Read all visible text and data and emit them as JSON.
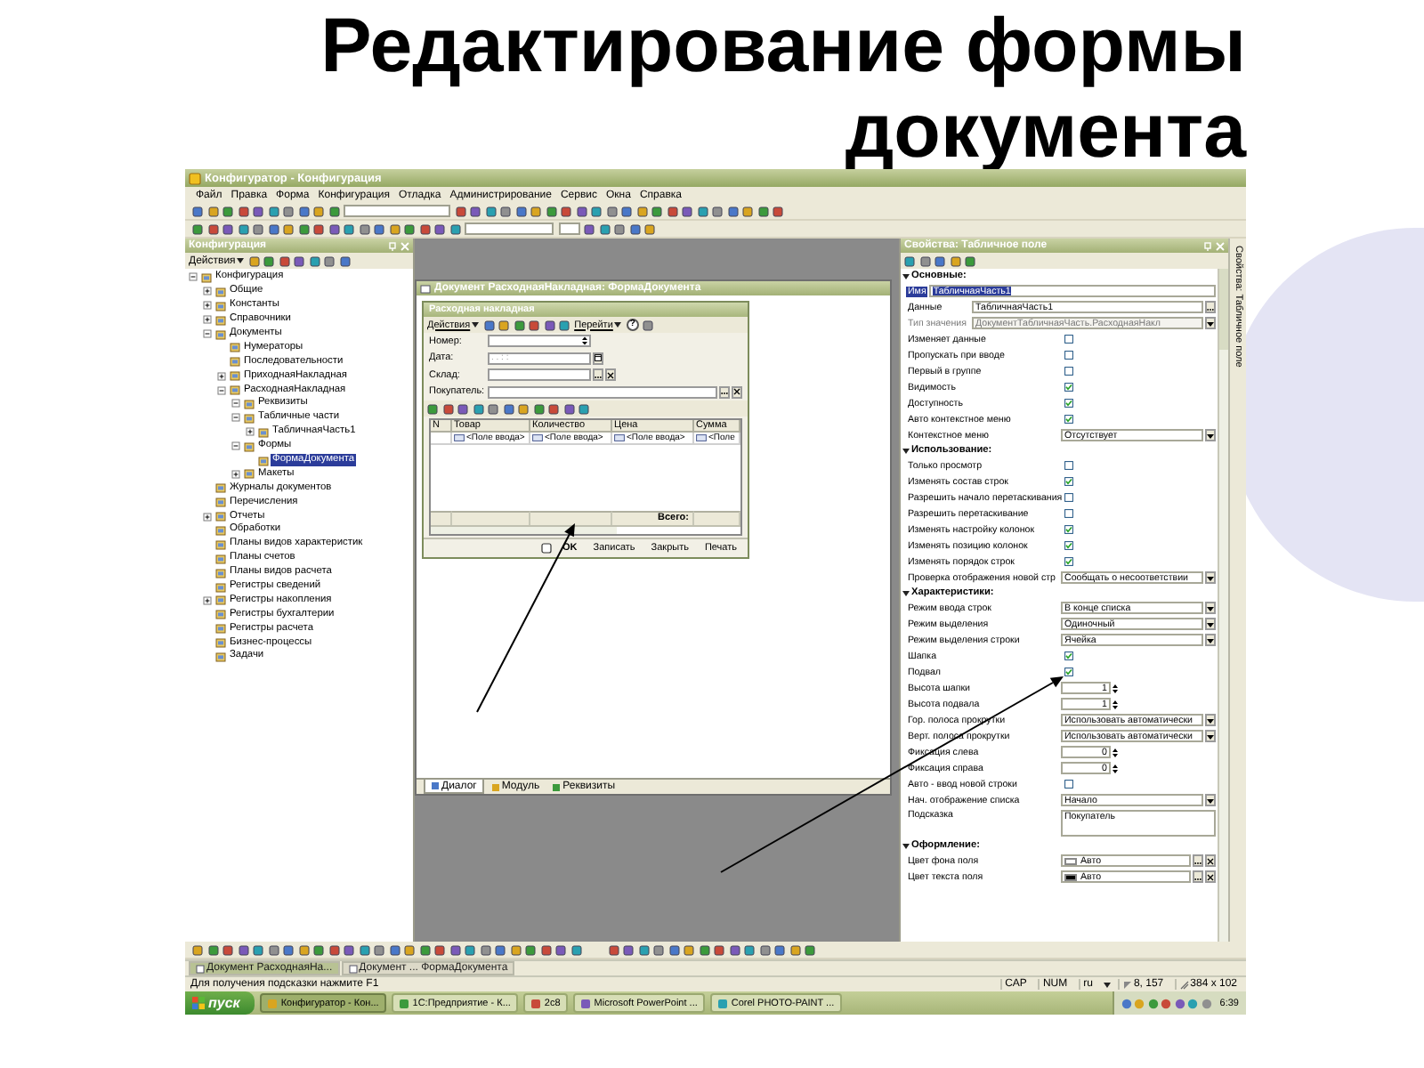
{
  "slide": {
    "title": "Редактирование формы документа"
  },
  "app": {
    "title": "Конфигуратор - Конфигурация",
    "menu": [
      "Файл",
      "Правка",
      "Форма",
      "Конфигурация",
      "Отладка",
      "Администрирование",
      "Сервис",
      "Окна",
      "Справка"
    ],
    "tree_panel": {
      "title": "Конфигурация",
      "actions_label": "Действия",
      "items": [
        {
          "label": "Конфигурация",
          "expanded": true,
          "selected": false,
          "children": [
            {
              "label": "Общие",
              "expanded": false,
              "selected": false
            },
            {
              "label": "Константы",
              "expanded": false,
              "selected": false
            },
            {
              "label": "Справочники",
              "expanded": false,
              "selected": false
            },
            {
              "label": "Документы",
              "expanded": true,
              "selected": false,
              "children": [
                {
                  "label": "Нумераторы",
                  "selected": false
                },
                {
                  "label": "Последовательности",
                  "selected": false
                },
                {
                  "label": "ПриходнаяНакладная",
                  "expanded": false,
                  "selected": false
                },
                {
                  "label": "РасходнаяНакладная",
                  "expanded": true,
                  "selected": false,
                  "children": [
                    {
                      "label": "Реквизиты",
                      "expanded": true,
                      "selected": false
                    },
                    {
                      "label": "Табличные части",
                      "expanded": true,
                      "selected": false,
                      "children": [
                        {
                          "label": "ТабличнаяЧасть1",
                          "expanded": false,
                          "selected": false
                        }
                      ]
                    },
                    {
                      "label": "Формы",
                      "expanded": true,
                      "selected": false,
                      "children": [
                        {
                          "label": "ФормаДокумента",
                          "selected": true
                        }
                      ]
                    },
                    {
                      "label": "Макеты",
                      "expanded": false,
                      "selected": false
                    }
                  ]
                }
              ]
            },
            {
              "label": "Журналы документов",
              "selected": false
            },
            {
              "label": "Перечисления",
              "selected": false
            },
            {
              "label": "Отчеты",
              "expanded": false,
              "selected": false
            },
            {
              "label": "Обработки",
              "selected": false
            },
            {
              "label": "Планы видов характеристик",
              "selected": false
            },
            {
              "label": "Планы счетов",
              "selected": false
            },
            {
              "label": "Планы видов расчета",
              "selected": false
            },
            {
              "label": "Регистры сведений",
              "selected": false
            },
            {
              "label": "Регистры накопления",
              "expanded": false,
              "selected": false
            },
            {
              "label": "Регистры бухгалтерии",
              "selected": false
            },
            {
              "label": "Регистры расчета",
              "selected": false
            },
            {
              "label": "Бизнес-процессы",
              "selected": false
            },
            {
              "label": "Задачи",
              "selected": false
            }
          ]
        }
      ]
    },
    "designer": {
      "title": "Документ РасходнаяНакладная: ФормаДокумента",
      "form": {
        "title": "Расходная накладная",
        "actions_label": "Действия",
        "goto_label": "Перейти",
        "help": "?",
        "fields": [
          {
            "label": "Номер:",
            "kind": "number",
            "wide": false
          },
          {
            "label": "Дата:",
            "kind": "date",
            "placeholder": ". . : :",
            "wide": false
          },
          {
            "label": "Склад:",
            "kind": "select",
            "wide": false
          },
          {
            "label": "Покупатель:",
            "kind": "select",
            "wide": true
          }
        ],
        "table": {
          "columns": [
            "N",
            "Товар",
            "Количество",
            "Цена",
            "Сумма"
          ],
          "rows": [
            [
              "",
              "<Поле ввода>",
              "<Поле ввода>",
              "<Поле ввода>",
              "<Поле"
            ]
          ],
          "footer": "Всего:"
        },
        "buttons": [
          {
            "label": "OK",
            "default": true
          },
          {
            "label": "Записать",
            "default": false
          },
          {
            "label": "Закрыть",
            "default": false
          },
          {
            "label": "Печать",
            "default": false
          }
        ]
      },
      "tabs": [
        {
          "label": "Диалог",
          "selected": true
        },
        {
          "label": "Модуль",
          "selected": false
        },
        {
          "label": "Реквизиты",
          "selected": false
        }
      ]
    },
    "properties": {
      "title": "Свойства: Табличное поле",
      "side_tab": "Свойства: Табличное поле",
      "sections": [
        {
          "title": "Основные:",
          "rows": [
            {
              "kind": "text",
              "label": "Имя",
              "value": "ТабличнаяЧасть1",
              "selected": true
            },
            {
              "kind": "select-more",
              "label": "Данные",
              "value": "ТабличнаяЧасть1",
              "disabled": false
            },
            {
              "kind": "select",
              "label": "Тип значения",
              "value": "ДокументТабличнаяЧасть.РасходнаяНакл",
              "disabled": true
            },
            {
              "kind": "check",
              "label": "Изменяет данные",
              "checked": false
            },
            {
              "kind": "check",
              "label": "Пропускать при вводе",
              "checked": false
            },
            {
              "kind": "check",
              "label": "Первый в группе",
              "checked": false
            },
            {
              "kind": "check",
              "label": "Видимость",
              "checked": true
            },
            {
              "kind": "check",
              "label": "Доступность",
              "checked": true
            },
            {
              "kind": "check",
              "label": "Авто контекстное меню",
              "checked": true
            },
            {
              "kind": "select",
              "label": "Контекстное меню",
              "value": "Отсутствует",
              "disabled": false
            }
          ]
        },
        {
          "title": "Использование:",
          "rows": [
            {
              "kind": "check",
              "label": "Только просмотр",
              "checked": false
            },
            {
              "kind": "check",
              "label": "Изменять состав строк",
              "checked": true
            },
            {
              "kind": "check",
              "label": "Разрешить начало перетаскивания",
              "checked": false
            },
            {
              "kind": "check",
              "label": "Разрешить перетаскивание",
              "checked": false
            },
            {
              "kind": "check",
              "label": "Изменять настройку колонок",
              "checked": true
            },
            {
              "kind": "check",
              "label": "Изменять позицию колонок",
              "checked": true
            },
            {
              "kind": "check",
              "label": "Изменять порядок строк",
              "checked": true
            },
            {
              "kind": "select",
              "label": "Проверка отображения новой стр",
              "value": "Сообщать о несоответствии",
              "disabled": false
            }
          ]
        },
        {
          "title": "Характеристики:",
          "rows": [
            {
              "kind": "select",
              "label": "Режим ввода строк",
              "value": "В конце списка",
              "disabled": false
            },
            {
              "kind": "select",
              "label": "Режим выделения",
              "value": "Одиночный",
              "disabled": false
            },
            {
              "kind": "select",
              "label": "Режим выделения строки",
              "value": "Ячейка",
              "disabled": false
            },
            {
              "kind": "check",
              "label": "Шапка",
              "checked": true
            },
            {
              "kind": "check",
              "label": "Подвал",
              "checked": true
            },
            {
              "kind": "spin",
              "label": "Высота шапки",
              "value": "1"
            },
            {
              "kind": "spin",
              "label": "Высота подвала",
              "value": "1"
            },
            {
              "kind": "select",
              "label": "Гор. полоса прокрутки",
              "value": "Использовать автоматически",
              "disabled": false
            },
            {
              "kind": "select",
              "label": "Верт. полоса прокрутки",
              "value": "Использовать автоматически",
              "disabled": false
            },
            {
              "kind": "spin",
              "label": "Фиксация слева",
              "value": "0"
            },
            {
              "kind": "spin",
              "label": "Фиксация справа",
              "value": "0"
            },
            {
              "kind": "check",
              "label": "Авто - ввод новой строки",
              "checked": false
            },
            {
              "kind": "select",
              "label": "Нач. отображение списка",
              "value": "Начало",
              "disabled": false
            },
            {
              "kind": "memo",
              "label": "Подсказка",
              "value": "Покупатель"
            }
          ]
        },
        {
          "title": "Оформление:",
          "rows": [
            {
              "kind": "color",
              "label": "Цвет фона поля",
              "value": "Авто",
              "color": "#ffffff"
            },
            {
              "kind": "color",
              "label": "Цвет текста поля",
              "value": "Авто",
              "color": "#000000"
            }
          ]
        }
      ]
    },
    "window_tabs": [
      {
        "label": "Документ РасходнаяНа...",
        "selected": true
      },
      {
        "label": "Документ ... ФормаДокумента",
        "selected": false
      }
    ],
    "status_bar": {
      "hint": "Для получения подсказки нажмите F1",
      "indicators": [
        "CAP",
        "NUM",
        "ru"
      ],
      "position": "8, 157",
      "size": "384 x 102"
    },
    "taskbar": {
      "start": "пуск",
      "tasks": [
        {
          "label": "Конфигуратор - Кон...",
          "selected": true
        },
        {
          "label": "1С:Предприятие - К...",
          "selected": false
        },
        {
          "label": "2c8",
          "selected": false
        },
        {
          "label": "Microsoft PowerPoint ...",
          "selected": false
        },
        {
          "label": "Corel PHOTO-PAINT ...",
          "selected": false
        }
      ],
      "clock": "6:39"
    }
  }
}
